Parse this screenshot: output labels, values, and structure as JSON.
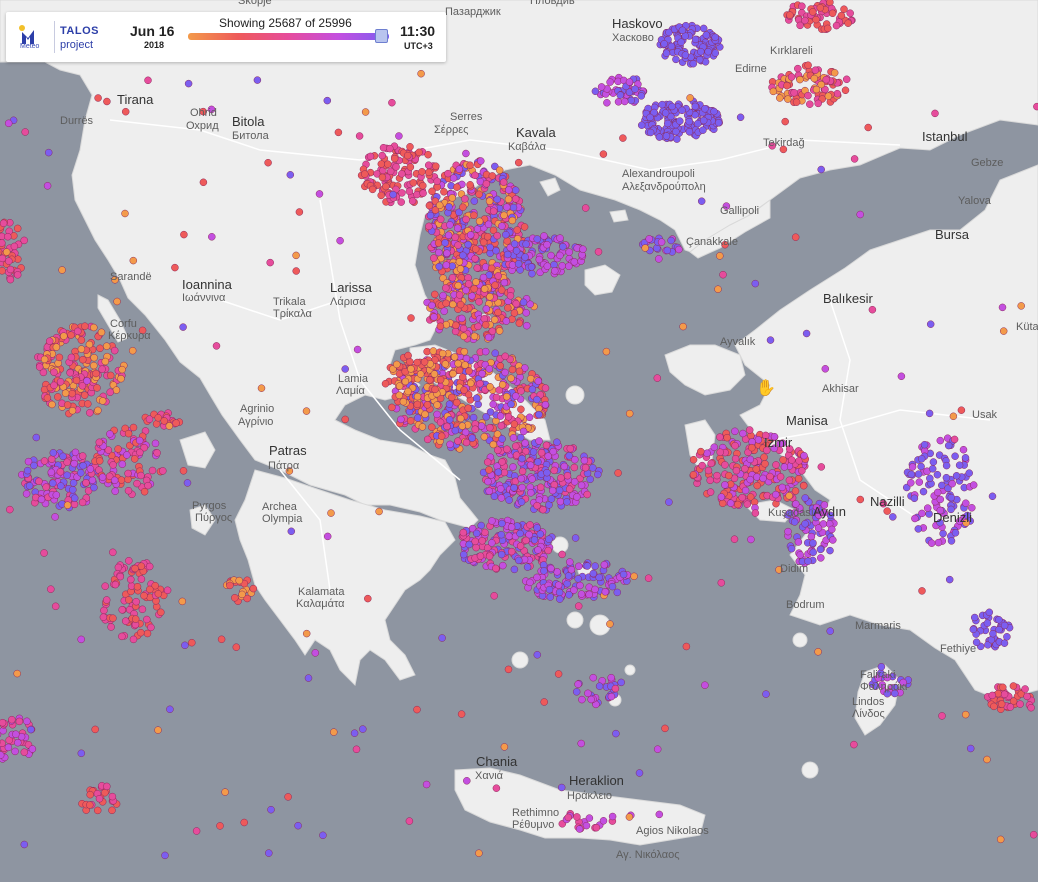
{
  "header": {
    "brand_meteo": "Meteo",
    "brand_talos": "TALOS",
    "brand_project": "project",
    "date": "Jun 16",
    "year": "2018",
    "showing": "Showing 25687 of 25996",
    "time": "11:30",
    "timezone": "UTC+3",
    "slider_position": 0.96,
    "gradient_colors": [
      "#f39a4a",
      "#ee5a5a",
      "#e64c9c",
      "#c34fe0",
      "#7b5ef0"
    ]
  },
  "colors": {
    "sea": "#8e95a1",
    "land": "#eeeeee",
    "road": "#ffffff",
    "accent": "#2c3ea8"
  },
  "cities": [
    {
      "name": "Tirana"
    },
    {
      "name": "Durrës"
    },
    {
      "name": "Ohrid"
    },
    {
      "name": "Охрид"
    },
    {
      "name": "Bitola"
    },
    {
      "name": "Битола"
    },
    {
      "name": "Skopje"
    },
    {
      "name": "Serres"
    },
    {
      "name": "Σέρρες"
    },
    {
      "name": "Kavala"
    },
    {
      "name": "Καβάλα"
    },
    {
      "name": "Haskovo"
    },
    {
      "name": "Хасково"
    },
    {
      "name": "Пазарджик"
    },
    {
      "name": "Пловдив"
    },
    {
      "name": "Edirne"
    },
    {
      "name": "Kırklareli"
    },
    {
      "name": "Tekirdağ"
    },
    {
      "name": "Istanbul"
    },
    {
      "name": "Gebze"
    },
    {
      "name": "Yalova"
    },
    {
      "name": "Bursa"
    },
    {
      "name": "Alexandroupoli"
    },
    {
      "name": "Αλεξανδρούπολη"
    },
    {
      "name": "Gallipoli"
    },
    {
      "name": "Çanakkale"
    },
    {
      "name": "Sarandë"
    },
    {
      "name": "Ioannina"
    },
    {
      "name": "Ιωάννινα"
    },
    {
      "name": "Corfu"
    },
    {
      "name": "Κέρκυρα"
    },
    {
      "name": "Trikala"
    },
    {
      "name": "Τρίκαλα"
    },
    {
      "name": "Larissa"
    },
    {
      "name": "Λάρισα"
    },
    {
      "name": "Balıkesir"
    },
    {
      "name": "Kütahya"
    },
    {
      "name": "Ayvalık"
    },
    {
      "name": "Akhisar"
    },
    {
      "name": "Lamia"
    },
    {
      "name": "Λαμία"
    },
    {
      "name": "Agrinio"
    },
    {
      "name": "Αγρίνιο"
    },
    {
      "name": "Manisa"
    },
    {
      "name": "Usak"
    },
    {
      "name": "Izmir"
    },
    {
      "name": "Patras"
    },
    {
      "name": "Πάτρα"
    },
    {
      "name": "Archea"
    },
    {
      "name": "Olympia"
    },
    {
      "name": "Pyrgos"
    },
    {
      "name": "Πύργος"
    },
    {
      "name": "Kalamata"
    },
    {
      "name": "Καλαμάτα"
    },
    {
      "name": "Nazilli"
    },
    {
      "name": "Denizli"
    },
    {
      "name": "Kuşadası"
    },
    {
      "name": "Aydın"
    },
    {
      "name": "Didim"
    },
    {
      "name": "Bodrum"
    },
    {
      "name": "Marmaris"
    },
    {
      "name": "Fethiye"
    },
    {
      "name": "Faliraki"
    },
    {
      "name": "Φαληράκι"
    },
    {
      "name": "Lindos"
    },
    {
      "name": "Λίνδος"
    },
    {
      "name": "Chania"
    },
    {
      "name": "Χανιά"
    },
    {
      "name": "Heraklion"
    },
    {
      "name": "Ηράκλειο"
    },
    {
      "name": "Rethimno"
    },
    {
      "name": "Ρέθυμνο"
    },
    {
      "name": "Agios Nikolaos"
    },
    {
      "name": "Αγ. Νικόλαος"
    }
  ]
}
